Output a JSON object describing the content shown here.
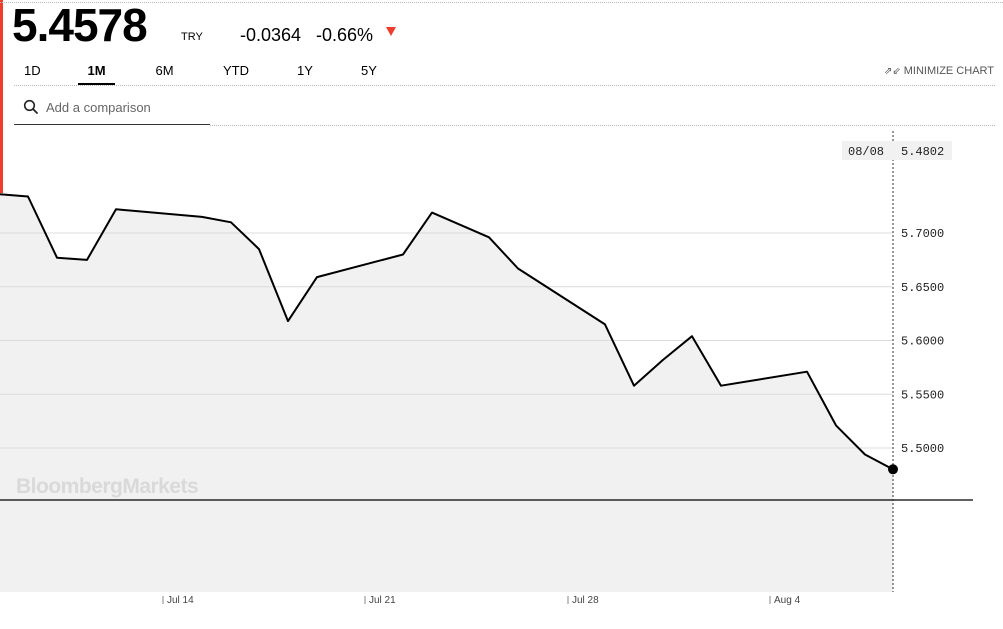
{
  "quote": {
    "price": "5.4578",
    "currency": "TRY",
    "change": "-0.0364",
    "change_pct": "-0.66%",
    "direction": "down",
    "down_color": "#f03c2c"
  },
  "tabs": [
    {
      "label": "1D",
      "active": false
    },
    {
      "label": "1M",
      "active": true
    },
    {
      "label": "6M",
      "active": false
    },
    {
      "label": "YTD",
      "active": false
    },
    {
      "label": "1Y",
      "active": false
    },
    {
      "label": "5Y",
      "active": false
    }
  ],
  "minimize_label": "MINIMIZE CHART",
  "search": {
    "placeholder": "Add a comparison",
    "value": ""
  },
  "chart_data": {
    "type": "area",
    "watermark": "BloombergMarkets",
    "crosshair": {
      "date": "08/08",
      "value": "5.4802"
    },
    "y_ticks": [
      "5.7000",
      "5.6500",
      "5.6000",
      "5.5500",
      "5.5000"
    ],
    "ylim": [
      5.43,
      5.78
    ],
    "x_ticks": [
      "Jul 14",
      "Jul 21",
      "Jul 28",
      "Aug 4"
    ],
    "grid": true,
    "line_color": "#000000",
    "fill_color": "#f1f1f1",
    "series": [
      {
        "values": [
          5.736,
          5.734,
          5.677,
          5.675,
          5.722,
          5.715,
          5.71,
          5.685,
          5.618,
          5.659,
          5.68,
          5.719,
          5.696,
          5.667,
          5.615,
          5.558,
          5.582,
          5.604,
          5.558,
          5.571,
          5.521,
          5.494,
          5.4802
        ]
      }
    ],
    "x_dates": [
      "Jul 9",
      "Jul 10",
      "Jul 11",
      "Jul 12",
      "Jul 13",
      "Jul 16",
      "Jul 17",
      "Jul 18",
      "Jul 19",
      "Jul 20",
      "Jul 23",
      "Jul 24",
      "Jul 25",
      "Jul 26",
      "Jul 30",
      "Jul 31",
      "Aug 1",
      "Aug 2",
      "Aug 3",
      "Aug 6",
      "Aug 7",
      "Aug 8",
      "Aug 8"
    ]
  }
}
